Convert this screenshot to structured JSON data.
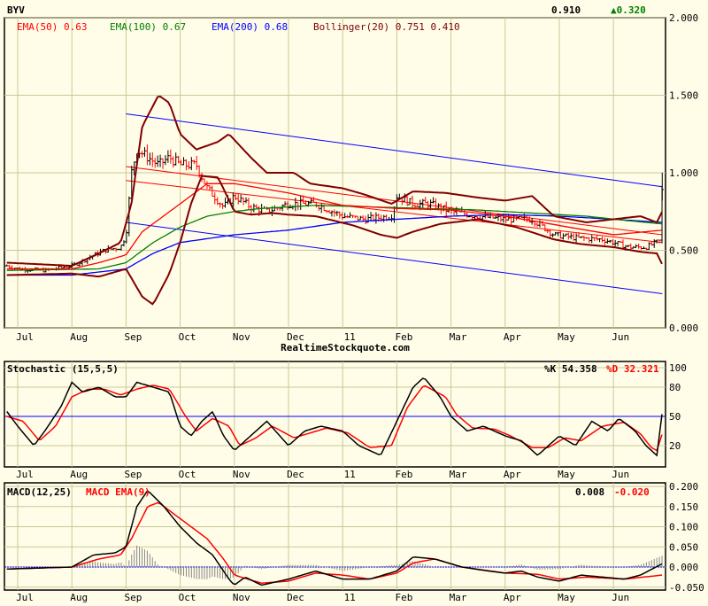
{
  "header": {
    "symbol": "BYV",
    "last": "0.910",
    "change": "▲0.320",
    "change_color": "#008000"
  },
  "legend": {
    "ema50": "EMA(50) 0.63",
    "ema100": "EMA(100) 0.67",
    "ema200": "EMA(200) 0.68",
    "bollinger": "Bollinger(20) 0.751 0.410"
  },
  "watermark": "RealtimeStockquote.com",
  "stoch": {
    "title": "Stochastic (15,5,5)",
    "k_label": "%K 54.358",
    "d_label": "%D 32.321"
  },
  "macd": {
    "title": "MACD(12,25)",
    "ema_label": "MACD EMA(9)",
    "macd_value": "0.008",
    "signal_value": "-0.020"
  },
  "chart_data": [
    {
      "type": "line",
      "title": "BYV price",
      "x_unit": "months since Jul 1",
      "x_ticks": [
        "Jul",
        "Aug",
        "Sep",
        "Oct",
        "Nov",
        "Dec",
        "11",
        "Feb",
        "Mar",
        "Apr",
        "May",
        "Jun"
      ],
      "y_ticks": [
        "2.000",
        "1.500",
        "1.000",
        "0.500",
        "0.000"
      ],
      "ylim": [
        0,
        2
      ],
      "colors": {
        "ema50": "#ff0000",
        "ema100": "#008000",
        "ema200": "#0000ff",
        "bollinger": "#800000",
        "channel": "#0000ff",
        "trend": "#ff0000"
      },
      "close": [
        [
          -0.2,
          0.4
        ],
        [
          0,
          0.38
        ],
        [
          0.5,
          0.37
        ],
        [
          1.0,
          0.4
        ],
        [
          1.3,
          0.45
        ],
        [
          1.6,
          0.5
        ],
        [
          1.9,
          0.52
        ],
        [
          2.0,
          0.6
        ],
        [
          2.1,
          1.0
        ],
        [
          2.2,
          1.15
        ],
        [
          2.4,
          1.1
        ],
        [
          2.6,
          1.05
        ],
        [
          2.8,
          1.1
        ],
        [
          3.0,
          1.05
        ],
        [
          3.3,
          1.05
        ],
        [
          3.5,
          0.9
        ],
        [
          3.8,
          0.78
        ],
        [
          4.0,
          0.85
        ],
        [
          4.3,
          0.78
        ],
        [
          4.6,
          0.75
        ],
        [
          5.0,
          0.8
        ],
        [
          5.5,
          0.8
        ],
        [
          6.0,
          0.72
        ],
        [
          6.4,
          0.7
        ],
        [
          6.9,
          0.72
        ],
        [
          7.0,
          0.85
        ],
        [
          7.3,
          0.8
        ],
        [
          7.6,
          0.8
        ],
        [
          8.0,
          0.75
        ],
        [
          8.5,
          0.72
        ],
        [
          9.0,
          0.7
        ],
        [
          9.5,
          0.7
        ],
        [
          9.9,
          0.6
        ],
        [
          10.3,
          0.58
        ],
        [
          10.8,
          0.57
        ],
        [
          11.3,
          0.52
        ],
        [
          11.6,
          0.52
        ],
        [
          11.85,
          0.56
        ],
        [
          11.9,
          0.91
        ]
      ],
      "ema50": [
        [
          -0.2,
          0.38
        ],
        [
          1.0,
          0.38
        ],
        [
          1.5,
          0.42
        ],
        [
          2.0,
          0.47
        ],
        [
          2.3,
          0.62
        ],
        [
          3.0,
          0.8
        ],
        [
          3.5,
          0.93
        ],
        [
          4.0,
          0.93
        ],
        [
          5.0,
          0.87
        ],
        [
          6.0,
          0.79
        ],
        [
          7.0,
          0.77
        ],
        [
          8.0,
          0.76
        ],
        [
          9.0,
          0.72
        ],
        [
          10,
          0.66
        ],
        [
          11,
          0.6
        ],
        [
          11.9,
          0.63
        ]
      ],
      "ema100": [
        [
          -0.2,
          0.37
        ],
        [
          1.5,
          0.38
        ],
        [
          2.0,
          0.42
        ],
        [
          2.5,
          0.55
        ],
        [
          3.0,
          0.65
        ],
        [
          3.5,
          0.72
        ],
        [
          4.0,
          0.75
        ],
        [
          4.5,
          0.77
        ],
        [
          5.5,
          0.79
        ],
        [
          6.5,
          0.78
        ],
        [
          7.5,
          0.77
        ],
        [
          8.5,
          0.76
        ],
        [
          9.5,
          0.74
        ],
        [
          10.5,
          0.72
        ],
        [
          11.3,
          0.69
        ],
        [
          11.9,
          0.67
        ]
      ],
      "ema200": [
        [
          -0.2,
          0.34
        ],
        [
          1.0,
          0.34
        ],
        [
          2.0,
          0.38
        ],
        [
          2.5,
          0.48
        ],
        [
          3.0,
          0.55
        ],
        [
          4.0,
          0.6
        ],
        [
          5.0,
          0.63
        ],
        [
          6.0,
          0.68
        ],
        [
          7.0,
          0.7
        ],
        [
          8.0,
          0.72
        ],
        [
          9.0,
          0.73
        ],
        [
          10,
          0.72
        ],
        [
          11,
          0.7
        ],
        [
          11.9,
          0.68
        ]
      ],
      "boll_upper": [
        [
          -0.2,
          0.42
        ],
        [
          1.0,
          0.4
        ],
        [
          1.5,
          0.48
        ],
        [
          1.9,
          0.55
        ],
        [
          2.1,
          0.8
        ],
        [
          2.3,
          1.3
        ],
        [
          2.6,
          1.5
        ],
        [
          2.8,
          1.45
        ],
        [
          3.0,
          1.25
        ],
        [
          3.3,
          1.15
        ],
        [
          3.7,
          1.2
        ],
        [
          3.9,
          1.25
        ],
        [
          4.3,
          1.1
        ],
        [
          4.6,
          1.0
        ],
        [
          5.1,
          1.0
        ],
        [
          5.4,
          0.93
        ],
        [
          6.0,
          0.9
        ],
        [
          6.4,
          0.86
        ],
        [
          6.9,
          0.8
        ],
        [
          7.3,
          0.88
        ],
        [
          7.9,
          0.87
        ],
        [
          8.5,
          0.84
        ],
        [
          9.0,
          0.82
        ],
        [
          9.5,
          0.85
        ],
        [
          9.9,
          0.72
        ],
        [
          10.5,
          0.68
        ],
        [
          11,
          0.7
        ],
        [
          11.5,
          0.72
        ],
        [
          11.8,
          0.68
        ],
        [
          11.9,
          0.75
        ]
      ],
      "boll_lower": [
        [
          -0.2,
          0.34
        ],
        [
          1.0,
          0.35
        ],
        [
          1.5,
          0.33
        ],
        [
          2.0,
          0.38
        ],
        [
          2.3,
          0.2
        ],
        [
          2.5,
          0.15
        ],
        [
          2.8,
          0.35
        ],
        [
          3.0,
          0.55
        ],
        [
          3.2,
          0.8
        ],
        [
          3.4,
          0.98
        ],
        [
          3.7,
          0.97
        ],
        [
          4.0,
          0.75
        ],
        [
          4.3,
          0.73
        ],
        [
          4.7,
          0.74
        ],
        [
          5.0,
          0.73
        ],
        [
          5.5,
          0.72
        ],
        [
          6.2,
          0.66
        ],
        [
          6.7,
          0.6
        ],
        [
          7.0,
          0.58
        ],
        [
          7.3,
          0.62
        ],
        [
          7.8,
          0.67
        ],
        [
          8.5,
          0.7
        ],
        [
          9.2,
          0.65
        ],
        [
          9.9,
          0.57
        ],
        [
          10.4,
          0.54
        ],
        [
          11.0,
          0.52
        ],
        [
          11.5,
          0.49
        ],
        [
          11.8,
          0.48
        ],
        [
          11.9,
          0.41
        ]
      ],
      "channel_upper": [
        [
          2.0,
          1.38
        ],
        [
          11.9,
          0.91
        ]
      ],
      "channel_lower": [
        [
          2.0,
          0.68
        ],
        [
          11.9,
          0.22
        ]
      ],
      "trend_lines": [
        [
          [
            2.0,
            1.04
          ],
          [
            11.9,
            0.6
          ]
        ],
        [
          [
            2.0,
            0.95
          ],
          [
            11.9,
            0.55
          ]
        ]
      ]
    },
    {
      "type": "line",
      "title": "Stochastic (15,5,5)",
      "ylim": [
        0,
        100
      ],
      "y_ticks": [
        "100",
        "80",
        "50",
        "20"
      ],
      "reference": 50,
      "k": [
        [
          -0.2,
          55
        ],
        [
          0,
          40
        ],
        [
          0.3,
          20
        ],
        [
          0.5,
          35
        ],
        [
          0.8,
          60
        ],
        [
          1.0,
          85
        ],
        [
          1.2,
          75
        ],
        [
          1.5,
          80
        ],
        [
          1.8,
          70
        ],
        [
          2.0,
          70
        ],
        [
          2.2,
          85
        ],
        [
          2.5,
          80
        ],
        [
          2.8,
          75
        ],
        [
          3.0,
          40
        ],
        [
          3.2,
          30
        ],
        [
          3.4,
          45
        ],
        [
          3.6,
          55
        ],
        [
          3.8,
          30
        ],
        [
          4.0,
          15
        ],
        [
          4.3,
          30
        ],
        [
          4.6,
          45
        ],
        [
          5.0,
          20
        ],
        [
          5.3,
          35
        ],
        [
          5.6,
          40
        ],
        [
          6.0,
          35
        ],
        [
          6.3,
          20
        ],
        [
          6.7,
          10
        ],
        [
          7.0,
          45
        ],
        [
          7.3,
          80
        ],
        [
          7.5,
          90
        ],
        [
          7.8,
          70
        ],
        [
          8.0,
          50
        ],
        [
          8.3,
          35
        ],
        [
          8.6,
          40
        ],
        [
          9.0,
          30
        ],
        [
          9.3,
          25
        ],
        [
          9.6,
          10
        ],
        [
          10,
          30
        ],
        [
          10.3,
          20
        ],
        [
          10.6,
          45
        ],
        [
          10.9,
          35
        ],
        [
          11.1,
          48
        ],
        [
          11.4,
          35
        ],
        [
          11.6,
          20
        ],
        [
          11.8,
          10
        ],
        [
          11.9,
          54
        ]
      ],
      "d": [
        [
          -0.2,
          50
        ],
        [
          0.1,
          45
        ],
        [
          0.4,
          25
        ],
        [
          0.7,
          40
        ],
        [
          1.0,
          70
        ],
        [
          1.3,
          78
        ],
        [
          1.6,
          78
        ],
        [
          1.9,
          72
        ],
        [
          2.2,
          78
        ],
        [
          2.5,
          82
        ],
        [
          2.8,
          78
        ],
        [
          3.1,
          50
        ],
        [
          3.3,
          35
        ],
        [
          3.6,
          48
        ],
        [
          3.9,
          40
        ],
        [
          4.1,
          20
        ],
        [
          4.4,
          28
        ],
        [
          4.7,
          40
        ],
        [
          5.1,
          28
        ],
        [
          5.4,
          33
        ],
        [
          5.7,
          38
        ],
        [
          6.1,
          33
        ],
        [
          6.5,
          18
        ],
        [
          6.9,
          20
        ],
        [
          7.2,
          60
        ],
        [
          7.5,
          82
        ],
        [
          7.9,
          70
        ],
        [
          8.1,
          52
        ],
        [
          8.4,
          38
        ],
        [
          8.8,
          37
        ],
        [
          9.1,
          30
        ],
        [
          9.5,
          18
        ],
        [
          9.8,
          18
        ],
        [
          10.1,
          28
        ],
        [
          10.4,
          25
        ],
        [
          10.8,
          40
        ],
        [
          11.2,
          44
        ],
        [
          11.5,
          32
        ],
        [
          11.7,
          18
        ],
        [
          11.8,
          15
        ],
        [
          11.9,
          32
        ]
      ]
    },
    {
      "type": "line",
      "title": "MACD(12,25)",
      "ylim": [
        -0.05,
        0.2
      ],
      "y_ticks": [
        "0.200",
        "0.150",
        "0.100",
        "0.050",
        "0.000",
        "-0.050"
      ],
      "macd": [
        [
          -0.2,
          -0.005
        ],
        [
          1.0,
          0
        ],
        [
          1.4,
          0.03
        ],
        [
          1.8,
          0.035
        ],
        [
          2.0,
          0.05
        ],
        [
          2.2,
          0.15
        ],
        [
          2.4,
          0.19
        ],
        [
          2.7,
          0.15
        ],
        [
          3.0,
          0.1
        ],
        [
          3.3,
          0.06
        ],
        [
          3.6,
          0.03
        ],
        [
          3.9,
          -0.03
        ],
        [
          4.0,
          -0.045
        ],
        [
          4.2,
          -0.025
        ],
        [
          4.5,
          -0.045
        ],
        [
          5.0,
          -0.03
        ],
        [
          5.5,
          -0.01
        ],
        [
          6.0,
          -0.03
        ],
        [
          6.5,
          -0.03
        ],
        [
          7.0,
          -0.01
        ],
        [
          7.3,
          0.025
        ],
        [
          7.7,
          0.02
        ],
        [
          8.2,
          0.0
        ],
        [
          8.7,
          -0.01
        ],
        [
          9.0,
          -0.015
        ],
        [
          9.3,
          -0.01
        ],
        [
          9.6,
          -0.025
        ],
        [
          10,
          -0.035
        ],
        [
          10.4,
          -0.02
        ],
        [
          10.8,
          -0.025
        ],
        [
          11.2,
          -0.03
        ],
        [
          11.5,
          -0.02
        ],
        [
          11.9,
          0.008
        ]
      ],
      "signal": [
        [
          -0.2,
          -0.005
        ],
        [
          1.0,
          0
        ],
        [
          1.5,
          0.02
        ],
        [
          1.9,
          0.03
        ],
        [
          2.1,
          0.07
        ],
        [
          2.4,
          0.15
        ],
        [
          2.6,
          0.16
        ],
        [
          3.0,
          0.12
        ],
        [
          3.5,
          0.07
        ],
        [
          3.8,
          0.02
        ],
        [
          4.0,
          -0.02
        ],
        [
          4.5,
          -0.04
        ],
        [
          5.0,
          -0.035
        ],
        [
          5.5,
          -0.015
        ],
        [
          6.0,
          -0.02
        ],
        [
          6.5,
          -0.03
        ],
        [
          7.0,
          -0.015
        ],
        [
          7.3,
          0.01
        ],
        [
          7.7,
          0.02
        ],
        [
          8.2,
          0.0
        ],
        [
          9.0,
          -0.015
        ],
        [
          9.6,
          -0.018
        ],
        [
          10,
          -0.03
        ],
        [
          10.5,
          -0.025
        ],
        [
          11.2,
          -0.03
        ],
        [
          11.9,
          -0.02
        ]
      ]
    }
  ]
}
